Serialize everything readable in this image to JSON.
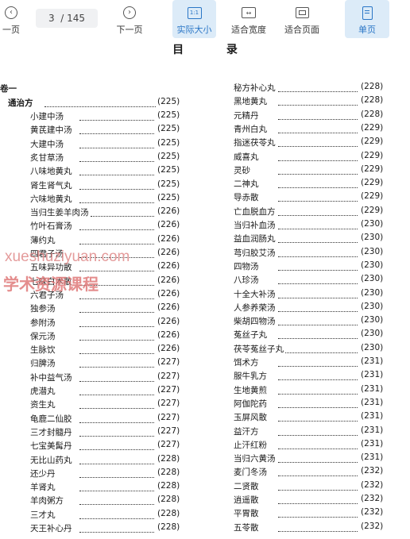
{
  "toolbar": {
    "prev_label": "一页",
    "page_current": "3",
    "page_total": "/ 145",
    "next_label": "下一页",
    "actual_size_label": "实际大小",
    "fit_width_label": "适合宽度",
    "fit_page_label": "适合页面",
    "single_page_label": "单页",
    "actual_size_icon_text": "1:1"
  },
  "document": {
    "title_chars": [
      "目",
      "录"
    ],
    "volume_label": "卷一",
    "section_label": "通治方",
    "section_page": "(225)",
    "left_entries": [
      {
        "name": "小建中汤",
        "page": "(225)"
      },
      {
        "name": "黄芪建中汤",
        "page": "(225)"
      },
      {
        "name": "大建中汤",
        "page": "(225)"
      },
      {
        "name": "炙甘草汤",
        "page": "(225)"
      },
      {
        "name": "八味地黄丸",
        "page": "(225)"
      },
      {
        "name": "肾生肾气丸",
        "page": "(225)"
      },
      {
        "name": "六味地黄丸",
        "page": "(225)"
      },
      {
        "name": "当归生姜羊肉汤",
        "page": "(226)"
      },
      {
        "name": "竹叶石膏汤",
        "page": "(226)"
      },
      {
        "name": "薄约丸",
        "page": "(226)"
      },
      {
        "name": "四君子汤",
        "page": "(226)"
      },
      {
        "name": "五味异功散",
        "page": "(226)"
      },
      {
        "name": "七味白术散",
        "page": "(226)"
      },
      {
        "name": "六君子汤",
        "page": "(226)"
      },
      {
        "name": "独参汤",
        "page": "(226)"
      },
      {
        "name": "参附汤",
        "page": "(226)"
      },
      {
        "name": "保元汤",
        "page": "(226)"
      },
      {
        "name": "生脉饮",
        "page": "(226)"
      },
      {
        "name": "归脾汤",
        "page": "(227)"
      },
      {
        "name": "补中益气汤",
        "page": "(227)"
      },
      {
        "name": "虎潜丸",
        "page": "(227)"
      },
      {
        "name": "资生丸",
        "page": "(227)"
      },
      {
        "name": "龟鹿二仙胶",
        "page": "(227)"
      },
      {
        "name": "三才封髓丹",
        "page": "(227)"
      },
      {
        "name": "七宝美髯丹",
        "page": "(227)"
      },
      {
        "name": "无比山药丸",
        "page": "(228)"
      },
      {
        "name": "还少丹",
        "page": "(228)"
      },
      {
        "name": "羊肾丸",
        "page": "(228)"
      },
      {
        "name": "羊肉粥方",
        "page": "(228)"
      },
      {
        "name": "三才丸",
        "page": "(228)"
      },
      {
        "name": "天王补心丹",
        "page": "(228)"
      }
    ],
    "right_entries": [
      {
        "name": "秘方补心丸",
        "page": "(228)"
      },
      {
        "name": "黑地黄丸",
        "page": "(228)"
      },
      {
        "name": "元精丹",
        "page": "(228)"
      },
      {
        "name": "青州白丸",
        "page": "(229)"
      },
      {
        "name": "指迷茯苓丸",
        "page": "(229)"
      },
      {
        "name": "威喜丸",
        "page": "(229)"
      },
      {
        "name": "灵砂",
        "page": "(229)"
      },
      {
        "name": "二神丸",
        "page": "(229)"
      },
      {
        "name": "导赤散",
        "page": "(229)"
      },
      {
        "name": "亡血脱血方",
        "page": "(229)"
      },
      {
        "name": "当归补血汤",
        "page": "(230)"
      },
      {
        "name": "益血润肠丸",
        "page": "(230)"
      },
      {
        "name": "芎归胶艾汤",
        "page": "(230)"
      },
      {
        "name": "四物汤",
        "page": "(230)"
      },
      {
        "name": "八珍汤",
        "page": "(230)"
      },
      {
        "name": "十全大补汤",
        "page": "(230)"
      },
      {
        "name": "人参养荣汤",
        "page": "(230)"
      },
      {
        "name": "柴胡四物汤",
        "page": "(230)"
      },
      {
        "name": "菟丝子丸",
        "page": "(230)"
      },
      {
        "name": "茯苓菟丝子丸",
        "page": "(230)"
      },
      {
        "name": "饵术方",
        "page": "(231)"
      },
      {
        "name": "服牛乳方",
        "page": "(231)"
      },
      {
        "name": "生地黄煎",
        "page": "(231)"
      },
      {
        "name": "阿伽陀药",
        "page": "(231)"
      },
      {
        "name": "玉屏风散",
        "page": "(231)"
      },
      {
        "name": "益汗方",
        "page": "(231)"
      },
      {
        "name": "止汗红粉",
        "page": "(231)"
      },
      {
        "name": "当归六黄汤",
        "page": "(231)"
      },
      {
        "name": "麦门冬汤",
        "page": "(232)"
      },
      {
        "name": "二贤散",
        "page": "(232)"
      },
      {
        "name": "逍遥散",
        "page": "(232)"
      },
      {
        "name": "平胃散",
        "page": "(232)"
      },
      {
        "name": "五苓散",
        "page": "(232)"
      }
    ]
  },
  "watermark": {
    "line1": "xueshuziyuan.com",
    "line2": "学术资源课程"
  },
  "colors": {
    "accent": "#2a76c6",
    "active_bg": "#dcebf8",
    "watermark": "#e08a8a"
  }
}
